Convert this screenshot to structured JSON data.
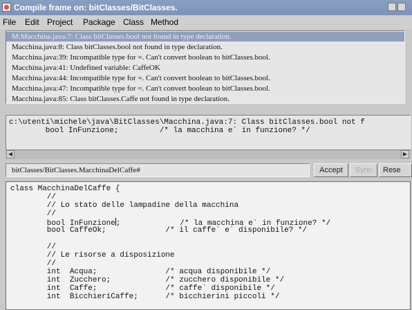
{
  "window": {
    "title": "Compile frame on: bitClasses/BitClasses."
  },
  "menu": [
    "File",
    "Edit",
    "Project",
    "Package",
    "Class",
    "Method"
  ],
  "errors": [
    "M:Macchina.java:7: Class bitClasses.bool not found in type declaration.",
    "Macchina.java:8: Class bitClasses.bool not found in type declaration.",
    "Macchina.java:39: Incompatible type for =. Can't convert boolean to bitClasses.bool.",
    "Macchina.java:41: Undefined variable: CaffeOK",
    "Macchina.java:44: Incompatible type for =. Can't convert boolean to bitClasses.bool.",
    "Macchina.java:47: Incompatible type for =. Can't convert boolean to bitClasses.bool.",
    "Macchina.java:85: Class bitClasses.Caffe not found in type declaration."
  ],
  "message": [
    "c:\\utenti\\michele\\java\\BitClasses\\Macchina.java:7: Class bitClasses.bool not f",
    "        bool InFunzione;         /* la macchina e` in funzione? */"
  ],
  "toolbar": {
    "class_field": "bitClasses/BitClasses.MacchinaDelCaffe#",
    "accept": "Accept",
    "sync": "Sync",
    "reset": "Rese"
  },
  "code": {
    "lines": [
      "class MacchinaDelCaffe {",
      "        //",
      "        // Lo stato delle lampadine della macchina",
      "        //",
      "        bool InFunzione",
      "        bool CaffeOk;             /* il caffe` e` disponibile? */",
      "",
      "        //",
      "        // Le risorse a disposizione",
      "        //",
      "        int  Acqua;               /* acqua disponibile */",
      "        int  Zucchero;            /* zucchero disponibile */",
      "        int  Caffe;               /* caffe` disponibile */",
      "        int  BicchieriCaffe;      /* bicchierini piccoli */"
    ],
    "caret_line_tail": ";             /* la macchina e` in funzione? */"
  }
}
